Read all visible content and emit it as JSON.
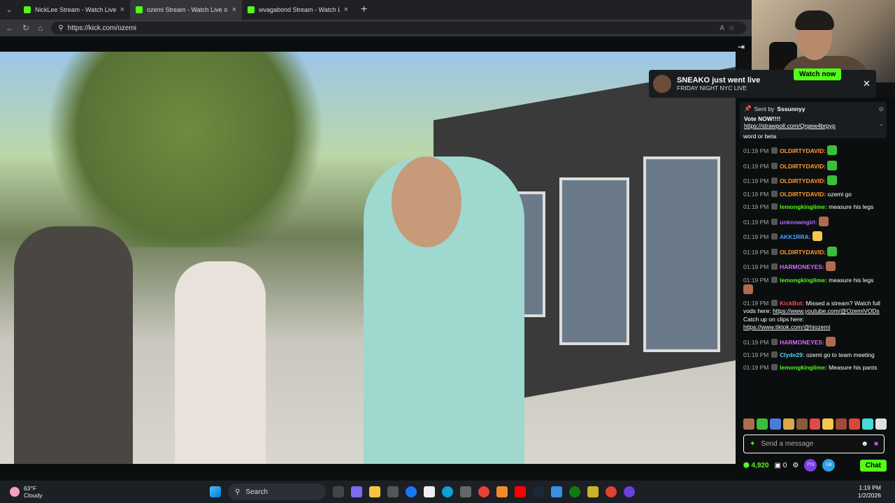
{
  "browser": {
    "tabs": [
      {
        "label": "NickLee Stream - Watch Live o",
        "active": false
      },
      {
        "label": "ozemi Stream - Watch Live o",
        "active": true
      },
      {
        "label": "wvagabond Stream - Watch Live o",
        "active": false
      }
    ],
    "url": "https://kick.com/ozemi"
  },
  "notification": {
    "title": "SNEAKO just went live",
    "subtitle": "FRIDAY NIGHT NYC LIVE",
    "button": "Watch now"
  },
  "pinned": {
    "sent_by": "Sent by",
    "user": "Sssunnyy",
    "text": "Vote NOW!!!!",
    "link": "https://strawpoll.com/Qrgew4brpyp"
  },
  "chat_messages": [
    {
      "time": "",
      "user": "",
      "user_color": "#ffffff",
      "text": "word or beta"
    },
    {
      "time": "01:19 PM",
      "user": "OLDIRTYDAVID:",
      "user_color": "#ff9b2e",
      "text": "",
      "emote": "#3bbf3b"
    },
    {
      "time": "01:19 PM",
      "user": "OLDIRTYDAVID:",
      "user_color": "#ff9b2e",
      "text": "",
      "emote": "#3bbf3b"
    },
    {
      "time": "01:19 PM",
      "user": "OLDIRTYDAVID:",
      "user_color": "#ff9b2e",
      "text": "",
      "emote": "#3bbf3b"
    },
    {
      "time": "01:19 PM",
      "user": "OLDIRTYDAVID:",
      "user_color": "#ff9b2e",
      "text": "ozemi go"
    },
    {
      "time": "01:19 PM",
      "user": "lemongkinglime:",
      "user_color": "#53fc18",
      "text": "measure his legs"
    },
    {
      "time": "01:19 PM",
      "user": "unknowngirl:",
      "user_color": "#b46bff",
      "text": "",
      "emote": "#b06a50"
    },
    {
      "time": "01:19 PM",
      "user": "AKK1RRA:",
      "user_color": "#4aa3ff",
      "text": "",
      "emote": "#f5c84b"
    },
    {
      "time": "01:19 PM",
      "user": "OLDIRTYDAVID:",
      "user_color": "#ff9b2e",
      "text": "",
      "emote": "#3bbf3b"
    },
    {
      "time": "01:19 PM",
      "user": "HARMONEYES:",
      "user_color": "#d36bff",
      "text": "",
      "emote": "#b06a50"
    },
    {
      "time": "01:19 PM",
      "user": "lemongkinglime:",
      "user_color": "#53fc18",
      "text": "measure his legs",
      "emote": "#b06a50"
    },
    {
      "time": "01:19 PM",
      "user": "KickBot:",
      "user_color": "#ff4a4a",
      "text": "Missed a stream? Watch full vods here: ",
      "link": "https://www.youtube.com/@OzemiVODs",
      "text2": " Catch up on clips here: ",
      "link2": "https://www.tiktok.com/@hiozemi"
    },
    {
      "time": "01:19 PM",
      "user": "HARMONEYES:",
      "user_color": "#d36bff",
      "text": "",
      "emote": "#b06a50"
    },
    {
      "time": "01:19 PM",
      "user": "Clyde29:",
      "user_color": "#4ad8ff",
      "text": "ozemi go to team meeting"
    },
    {
      "time": "01:19 PM",
      "user": "lemongkinglime:",
      "user_color": "#53fc18",
      "text": "Measure his pants"
    }
  ],
  "chat_input": {
    "placeholder": "Send a message"
  },
  "chat_footer": {
    "points": "4,920",
    "count": "0",
    "badge1": "7TV",
    "badge2": "GB",
    "chat_button": "Chat"
  },
  "emote_colors": [
    "#b06a50",
    "#3bbf3b",
    "#4a7bd8",
    "#d8a84a",
    "#8a5a3a",
    "#e04a4a",
    "#f5c84b",
    "#a04a3a",
    "#d8483a",
    "#4ad8d8",
    "#e0e0e0"
  ],
  "taskbar": {
    "temp": "63°F",
    "condition": "Cloudy",
    "search": "Search",
    "time": "1:19 PM",
    "date": "1/2/2026"
  }
}
